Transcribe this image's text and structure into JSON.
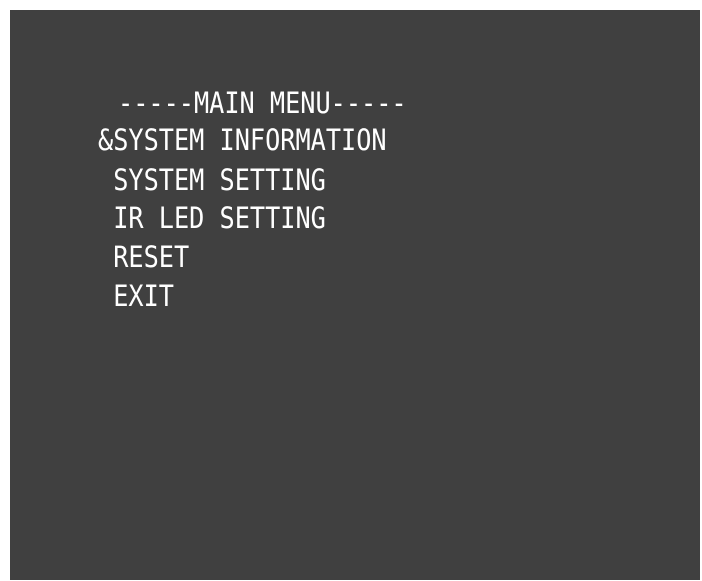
{
  "menu": {
    "title": "-----MAIN MENU-----",
    "cursor": "&",
    "items": [
      {
        "text": "&SYSTEM INFORMATION"
      },
      {
        "text": " SYSTEM SETTING"
      },
      {
        "text": " IR LED SETTING"
      },
      {
        "text": " RESET"
      },
      {
        "text": " EXIT"
      }
    ]
  },
  "colors": {
    "background": "#404040",
    "text": "#ffffff",
    "frame": "#ffffff"
  }
}
